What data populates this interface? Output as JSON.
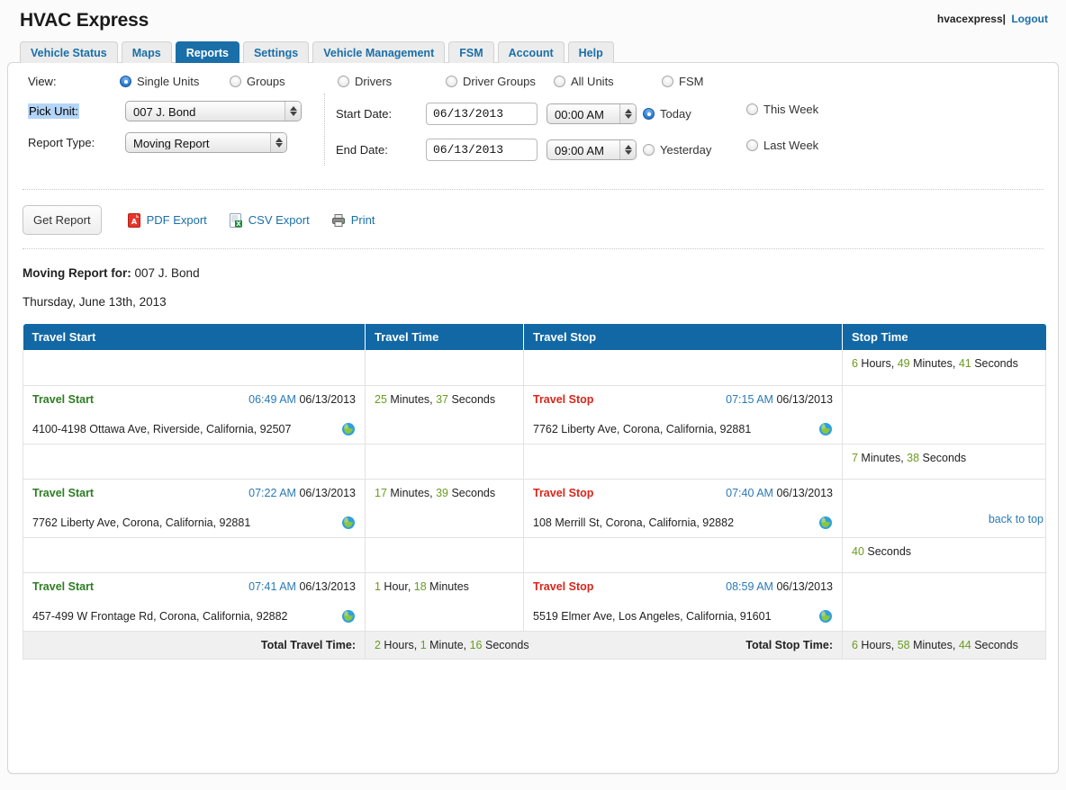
{
  "header": {
    "app_title": "HVAC Express",
    "username": "hvacexpress|",
    "logout_label": "Logout"
  },
  "tabs": [
    {
      "label": "Vehicle Status",
      "active": false
    },
    {
      "label": "Maps",
      "active": false
    },
    {
      "label": "Reports",
      "active": true
    },
    {
      "label": "Settings",
      "active": false
    },
    {
      "label": "Vehicle Management",
      "active": false
    },
    {
      "label": "FSM",
      "active": false
    },
    {
      "label": "Account",
      "active": false
    },
    {
      "label": "Help",
      "active": false
    }
  ],
  "filters": {
    "view_label": "View:",
    "view_options": [
      {
        "label": "Single Units",
        "selected": true
      },
      {
        "label": "Groups",
        "selected": false
      },
      {
        "label": "Drivers",
        "selected": false
      },
      {
        "label": "Driver Groups",
        "selected": false
      },
      {
        "label": "All Units",
        "selected": false
      },
      {
        "label": "FSM",
        "selected": false
      }
    ],
    "pick_unit_label": "Pick Unit:",
    "pick_unit_value": "007 J. Bond",
    "report_type_label": "Report Type:",
    "report_type_value": "Moving Report",
    "start_date_label": "Start Date:",
    "start_date_value": "06/13/2013",
    "start_time_value": "00:00 AM",
    "end_date_label": "End Date:",
    "end_date_value": "06/13/2013",
    "end_time_value": "09:00 AM",
    "quick_today": "Today",
    "quick_this_week": "This Week",
    "quick_yesterday": "Yesterday",
    "quick_last_week": "Last Week",
    "quick_selected": "Today"
  },
  "actions": {
    "get_report_label": "Get Report",
    "pdf_export_label": "PDF Export",
    "csv_export_label": "CSV Export",
    "print_label": "Print",
    "pdf_icon": "pdf-icon",
    "csv_icon": "csv-icon",
    "print_icon": "printer-icon"
  },
  "report": {
    "title_prefix": "Moving Report for:",
    "title_unit": "007 J. Bond",
    "date_line": "Thursday, June 13th, 2013",
    "columns": [
      "Travel Start",
      "Travel Time",
      "Travel Stop",
      "Stop Time"
    ],
    "start_label": "Travel Start",
    "stop_label": "Travel Stop",
    "globe_icon": "globe-icon",
    "leading_stop": {
      "num1": "6",
      "word1": " Hours, ",
      "num2": "49",
      "word2": " Minutes, ",
      "num3": "41",
      "word3": " Seconds"
    },
    "trips": [
      {
        "start_time": "06:49 AM",
        "start_date": "06/13/2013",
        "start_address": "4100-4198 Ottawa Ave, Riverside, California, 92507",
        "travel_num1": "25",
        "travel_word1": " Minutes, ",
        "travel_num2": "37",
        "travel_word2": " Seconds",
        "travel_num3": "",
        "travel_word3": "",
        "stop_time": "07:15 AM",
        "stop_date": "06/13/2013",
        "stop_address": "7762 Liberty Ave, Corona, California, 92881",
        "after_num1": "7",
        "after_word1": " Minutes, ",
        "after_num2": "38",
        "after_word2": " Seconds",
        "after_num3": "",
        "after_word3": ""
      },
      {
        "start_time": "07:22 AM",
        "start_date": "06/13/2013",
        "start_address": "7762 Liberty Ave, Corona, California, 92881",
        "travel_num1": "17",
        "travel_word1": " Minutes, ",
        "travel_num2": "39",
        "travel_word2": " Seconds",
        "travel_num3": "",
        "travel_word3": "",
        "stop_time": "07:40 AM",
        "stop_date": "06/13/2013",
        "stop_address": "108 Merrill St, Corona, California, 92882",
        "after_num1": "40",
        "after_word1": " Seconds",
        "after_num2": "",
        "after_word2": "",
        "after_num3": "",
        "after_word3": ""
      },
      {
        "start_time": "07:41 AM",
        "start_date": "06/13/2013",
        "start_address": "457-499 W Frontage Rd, Corona, California, 92882",
        "travel_num1": "1",
        "travel_word1": " Hour, ",
        "travel_num2": "18",
        "travel_word2": " Minutes",
        "travel_num3": "",
        "travel_word3": "",
        "stop_time": "08:59 AM",
        "stop_date": "06/13/2013",
        "stop_address": "5519 Elmer Ave, Los Angeles, California, 91601",
        "after_num1": "",
        "after_word1": "",
        "after_num2": "",
        "after_word2": "",
        "after_num3": "",
        "after_word3": ""
      }
    ],
    "totals": {
      "travel_label": "Total Travel Time:",
      "travel_num1": "2",
      "travel_word1": " Hours, ",
      "travel_num2": "1",
      "travel_word2": " Minute, ",
      "travel_num3": "16",
      "travel_word3": " Seconds",
      "stop_label": "Total Stop Time:",
      "stop_num1": "6",
      "stop_word1": " Hours, ",
      "stop_num2": "58",
      "stop_word2": " Minutes, ",
      "stop_num3": "44",
      "stop_word3": " Seconds"
    },
    "back_to_top": "back to top"
  },
  "colors": {
    "accent": "#1268a5",
    "link": "#1a6fa8",
    "start_green": "#2e7d23",
    "stop_red": "#d8261c",
    "number_green": "#6a9b1f",
    "time_blue": "#2a7ab5"
  }
}
